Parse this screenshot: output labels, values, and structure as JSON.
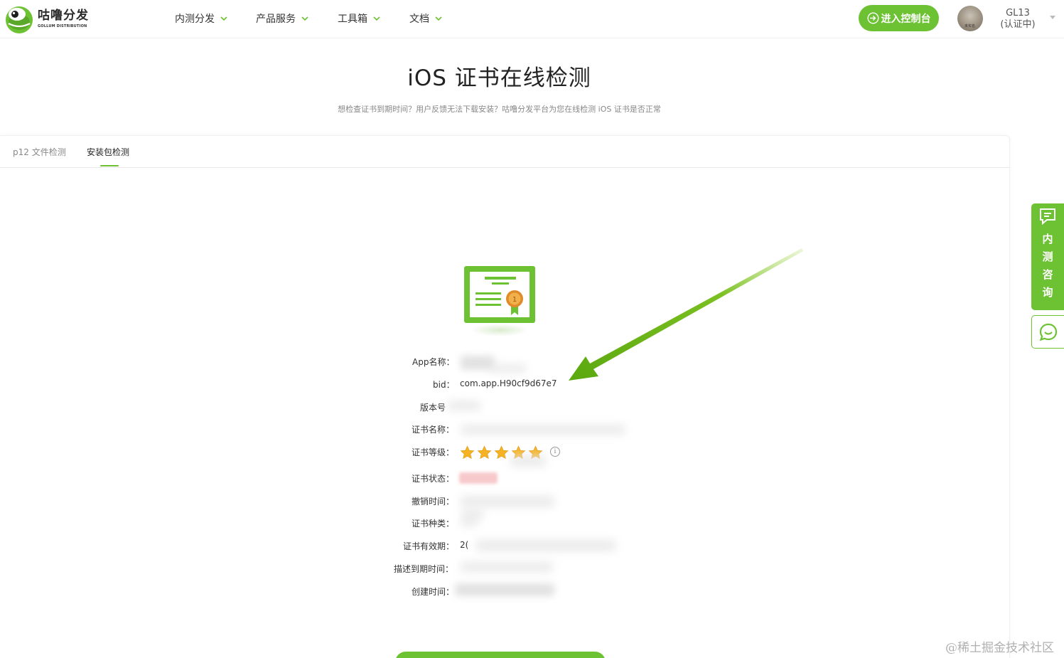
{
  "brand": {
    "name_cn": "咕噜分发",
    "name_en": "GOLLUM DISTRIBUTION",
    "accent_color": "#6cc232"
  },
  "nav": {
    "items": [
      {
        "label": "内测分发",
        "icon": "chevron-down-icon"
      },
      {
        "label": "产品服务",
        "icon": "chevron-down-icon"
      },
      {
        "label": "工具箱",
        "icon": "chevron-down-icon"
      },
      {
        "label": "文档",
        "icon": "chevron-down-icon"
      }
    ]
  },
  "header": {
    "console_button": "进入控制台",
    "avatar_tag": "未实名",
    "user_name": "GL13",
    "user_status": "(认证中)"
  },
  "page": {
    "title": "iOS 证书在线检测",
    "subtitle": "想检查证书到期时间？用户反馈无法下载安装？咕噜分发平台为您在线检测 iOS 证书是否正常"
  },
  "tabs": [
    {
      "label": "p12 文件检测",
      "active": false
    },
    {
      "label": "安装包检测",
      "active": true
    }
  ],
  "info": {
    "rows": [
      {
        "label": "App名称：",
        "value": ""
      },
      {
        "label": "bid：",
        "value": "com.app.H90cf9d67e7"
      },
      {
        "label": "版本号",
        "value": ""
      },
      {
        "label": "证书名称：",
        "value": ""
      },
      {
        "label": "证书等级：",
        "value": ""
      },
      {
        "label": "证书状态：",
        "value": ""
      },
      {
        "label": "撤销时间：",
        "value": ""
      },
      {
        "label": "证书种类：",
        "value": ""
      },
      {
        "label": "证书有效期：",
        "value": "2("
      },
      {
        "label": "描述到期时间：",
        "value": ""
      },
      {
        "label": "创建时间：",
        "value": ""
      }
    ],
    "rating": 5,
    "rating_max": 5
  },
  "float_panel": {
    "label": "内测咨询",
    "chars": [
      "内",
      "测",
      "咨",
      "询"
    ]
  },
  "watermark": "@稀土掘金技术社区"
}
